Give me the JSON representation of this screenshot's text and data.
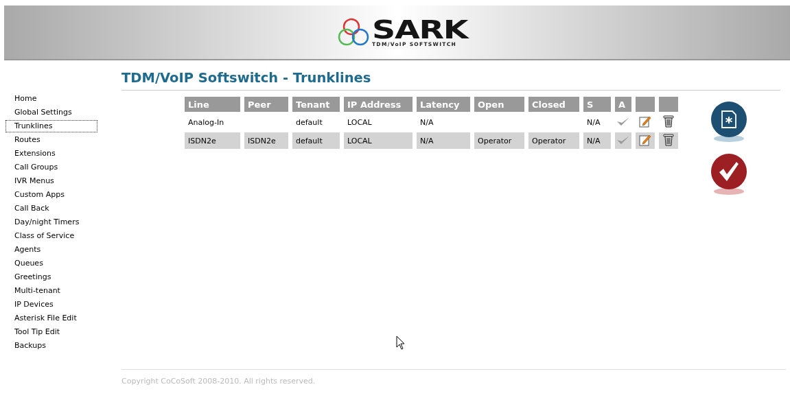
{
  "logo": {
    "name": "SARK",
    "tagline": "TDM/VoIP SOFTSWITCH"
  },
  "sidebar": {
    "items": [
      {
        "label": "Home",
        "selected": false
      },
      {
        "label": "Global Settings",
        "selected": false
      },
      {
        "label": "Trunklines",
        "selected": true
      },
      {
        "label": "Routes",
        "selected": false
      },
      {
        "label": "Extensions",
        "selected": false
      },
      {
        "label": "Call Groups",
        "selected": false
      },
      {
        "label": "IVR Menus",
        "selected": false
      },
      {
        "label": "Custom Apps",
        "selected": false
      },
      {
        "label": "Call Back",
        "selected": false
      },
      {
        "label": "Day/night Timers",
        "selected": false
      },
      {
        "label": "Class of Service",
        "selected": false
      },
      {
        "label": "Agents",
        "selected": false
      },
      {
        "label": "Queues",
        "selected": false
      },
      {
        "label": "Greetings",
        "selected": false
      },
      {
        "label": "Multi-tenant",
        "selected": false
      },
      {
        "label": "IP Devices",
        "selected": false
      },
      {
        "label": "Asterisk File Edit",
        "selected": false
      },
      {
        "label": "Tool Tip Edit",
        "selected": false
      },
      {
        "label": "Backups",
        "selected": false
      }
    ]
  },
  "page_title": "TDM/VoIP Softswitch - Trunklines",
  "table": {
    "columns": [
      "Line",
      "Peer",
      "Tenant",
      "IP Address",
      "Latency",
      "Open",
      "Closed",
      "S",
      "A"
    ],
    "rows": [
      {
        "cells": [
          "Analog-In",
          "",
          "default",
          "LOCAL",
          "N/A",
          "",
          "",
          "N/A"
        ]
      },
      {
        "cells": [
          "ISDN2e",
          "ISDN2e",
          "default",
          "LOCAL",
          "N/A",
          "Operator",
          "Operator",
          "N/A"
        ]
      }
    ]
  },
  "footer": "Copyright CoCoSoft 2008-2010. All rights reserved."
}
